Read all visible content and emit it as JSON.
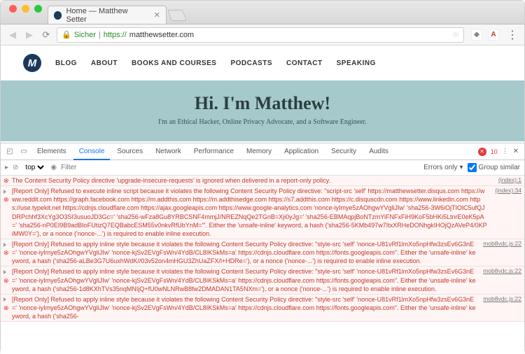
{
  "window": {
    "tab_title": "Home — Matthew Setter"
  },
  "url_bar": {
    "secure_label": "Sicher",
    "scheme": "https://",
    "host": "matthewsetter.com"
  },
  "page": {
    "brand_letter": "M",
    "nav_items": [
      "BLOG",
      "ABOUT",
      "BOOKS AND COURSES",
      "PODCASTS",
      "CONTACT",
      "SPEAKING"
    ],
    "hero_title": "Hi. I'm Matthew!",
    "hero_subtitle": "I'm an Ethical Hacker, Online Privacy Advocate, and a Software Engineer."
  },
  "devtools": {
    "tabs": [
      "Elements",
      "Console",
      "Sources",
      "Network",
      "Performance",
      "Memory",
      "Application",
      "Security",
      "Audits"
    ],
    "active_tab": "Console",
    "error_count": "10",
    "context": "top",
    "filter_placeholder": "Filter",
    "errors_only_label": "Errors only",
    "group_similar_label": "Group similar",
    "logs": [
      {
        "type": "error",
        "text": "The Content Security Policy directive 'upgrade-insecure-requests' is ignored when delivered in a report-only policy.",
        "src": "(index):1"
      },
      {
        "type": "error",
        "text": "[Report Only] Refused to execute inline script because it violates the following Content Security Policy directive: \"script-src 'self' https://matthewsetter.disqus.com https://www.reddit.com https://graph.facebook.com https://m.addthis.com https://m.addthisedge.com https://s7.addthis.com https://c.disquscdn.com https://www.linkedin.com https://use.typekit.net https://cdnjs.cloudflare.com https://ajax.googleapis.com https://www.google-analytics.com 'nonce-iyImye5zAOhgwYVgliJIw' 'sha256-3W6iOjTIOlC5ufQJDRPchhf3XcYg3O3SI3usuoJD3Gc=' 'sha256-wFza8Gu8YRBCSNF4mmjJ/NREZNqQe2TGnB=Xji0yJg=' 'sha256-EBMAqpjBoNTzmYiFNFxFiH9KoF5bHKi5LtnrE0eK5pA=' 'sha256-nP0EI9B9adBIoFUtizQ7EQBabcESM55v0nkvRfUbYnM='\". Either the 'unsafe-inline' keyword, a hash ('sha256-5KMb497w7ItxXRHeDONhgkIHOjQzAVeP4/0KPiMW0Y='), or a nonce ('nonce-...') is required to enable inline execution.",
        "src": "(index):34"
      },
      {
        "type": "error",
        "text": "[Report Only] Refused to apply inline style because it violates the following Content Security Policy directive: \"style-src 'self' 'nonce-U81vRf1lmXo5npHfw3zsEv6G3nE=' 'nonce-iyImye5zAOhgwYVgliJIw' 'nonce-kjSv2EVgFsWn/4YdB/CL8IKSkMs=a' https://cdnjs.cloudflare.com https://fonts.googleapis.com\". Either the 'unsafe-inline' keyword, a hash ('sha256-aLBe3G7U6uxhWdK//03v52on4mHGU3ZhUaZFX/l+HDRe='), or a nonce ('nonce-...') is required to enable inline execution.",
        "src": "mob8vdc.js:22"
      },
      {
        "type": "error",
        "text": "[Report Only] Refused to apply inline style because it violates the following Content Security Policy directive: \"style-src 'self' 'nonce-U81vRf1lmXo5npHfw3zsEv6G3nE=' 'nonce-iyImye5zAOhgwYVgliJIw' 'nonce-kjSv2EVgFsWn/4YdB/CL8IKSkMs=a' https://cdnjs.cloudflare.com https://fonts.googleapis.com\". Either the 'unsafe-inline' keyword, a hash ('sha256-1d8KXhTVs35nqMNIjQ+fU0wNLNRwB8fw2DMADAN1TA5NXm='), or a nonce ('nonce-...') is required to enable inline execution.",
        "src": "mob8vdc.js:22"
      },
      {
        "type": "error",
        "text": "[Report Only] Refused to apply inline style because it violates the following Content Security Policy directive: \"style-src 'self' 'nonce-U81vRf1lmXo5npHfw3zsEv6G3nE=' 'nonce-iyImye5zAOhgwYVgliJIw' 'nonce-kjSv2EVgFsWn/4YdB/CL8IKSkMs=a' https://cdnjs.cloudflare.com https://fonts.googleapis.com\". Either the 'unsafe-inline' keyword, a hash ('sha256-",
        "src": "mob8vdc.js:22"
      }
    ]
  }
}
